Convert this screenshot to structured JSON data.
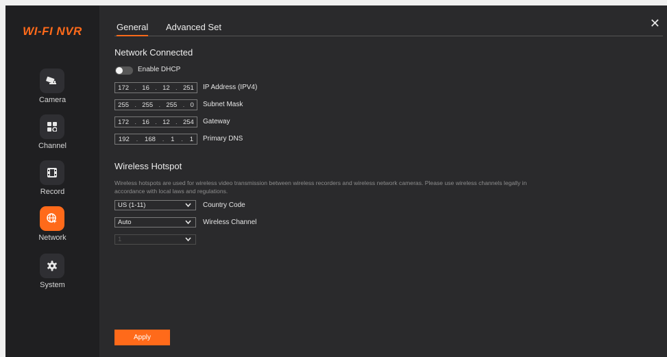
{
  "app": {
    "logo": "WI-FI NVR"
  },
  "sidebar": {
    "items": [
      {
        "label": "Camera",
        "icon": "camera-icon",
        "active": false
      },
      {
        "label": "Channel",
        "icon": "grid-icon",
        "active": false
      },
      {
        "label": "Record",
        "icon": "film-icon",
        "active": false
      },
      {
        "label": "Network",
        "icon": "globe-icon",
        "active": true
      },
      {
        "label": "System",
        "icon": "gear-icon",
        "active": false
      }
    ]
  },
  "tabs": [
    {
      "label": "General",
      "active": true
    },
    {
      "label": "Advanced Set",
      "active": false
    }
  ],
  "close_glyph": "✕",
  "network": {
    "title": "Network Connected",
    "dhcp_label": "Enable DHCP",
    "dhcp_enabled": false,
    "fields": [
      {
        "label": "IP Address (IPV4)",
        "octets": [
          "172",
          "16",
          "12",
          "251"
        ]
      },
      {
        "label": "Subnet Mask",
        "octets": [
          "255",
          "255",
          "255",
          "0"
        ]
      },
      {
        "label": "Gateway",
        "octets": [
          "172",
          "16",
          "12",
          "254"
        ]
      },
      {
        "label": "Primary DNS",
        "octets": [
          "192",
          "168",
          "1",
          "1"
        ]
      }
    ]
  },
  "hotspot": {
    "title": "Wireless Hotspot",
    "description": "Wireless hotspots are used for wireless video transmission between wireless recorders and wireless network cameras. Please use wireless channels legally in accordance with local laws and regulations.",
    "country_code": {
      "value": "US (1-11)",
      "label": "Country Code"
    },
    "wireless_channel": {
      "value": "Auto",
      "label": "Wireless Channel"
    },
    "channel_number": {
      "value": "1",
      "disabled": true
    }
  },
  "apply_label": "Apply",
  "colors": {
    "accent": "#ff6a1a",
    "background": "#2a2a2c",
    "sidebar": "#1f1f21"
  }
}
